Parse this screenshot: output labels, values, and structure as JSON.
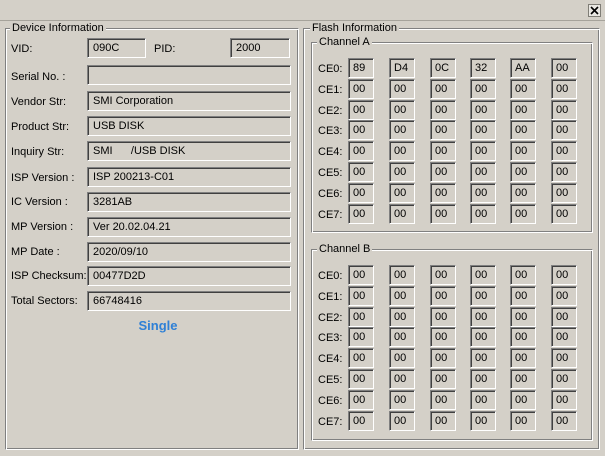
{
  "window": {
    "close_label": "close"
  },
  "device": {
    "title": "Device Information",
    "vid_label": "VID:",
    "vid": "090C",
    "pid_label": "PID:",
    "pid": "2000",
    "serial_label": "Serial No. :",
    "serial": "",
    "vendor_label": "Vendor Str:",
    "vendor": "SMI Corporation",
    "product_label": "Product Str:",
    "product": "USB DISK",
    "inquiry_label": "Inquiry Str:",
    "inquiry": "SMI      /USB DISK",
    "isp_version_label": "ISP Version :",
    "isp_version": "ISP 200213-C01",
    "ic_version_label": "IC Version :",
    "ic_version": "3281AB",
    "mp_version_label": "MP Version :",
    "mp_version": "Ver 20.02.04.21",
    "mp_date_label": "MP Date :",
    "mp_date": "2020/09/10",
    "isp_checksum_label": "ISP Checksum:",
    "isp_checksum": "00477D2D",
    "total_sectors_label": "Total Sectors:",
    "total_sectors": "66748416",
    "mode": "Single",
    "mode_color": "#2f80d6"
  },
  "flash": {
    "title": "Flash Information",
    "channels": [
      {
        "title": "Channel A",
        "rows": [
          {
            "label": "CE0:",
            "values": [
              "89",
              "D4",
              "0C",
              "32",
              "AA",
              "00"
            ]
          },
          {
            "label": "CE1:",
            "values": [
              "00",
              "00",
              "00",
              "00",
              "00",
              "00"
            ]
          },
          {
            "label": "CE2:",
            "values": [
              "00",
              "00",
              "00",
              "00",
              "00",
              "00"
            ]
          },
          {
            "label": "CE3:",
            "values": [
              "00",
              "00",
              "00",
              "00",
              "00",
              "00"
            ]
          },
          {
            "label": "CE4:",
            "values": [
              "00",
              "00",
              "00",
              "00",
              "00",
              "00"
            ]
          },
          {
            "label": "CE5:",
            "values": [
              "00",
              "00",
              "00",
              "00",
              "00",
              "00"
            ]
          },
          {
            "label": "CE6:",
            "values": [
              "00",
              "00",
              "00",
              "00",
              "00",
              "00"
            ]
          },
          {
            "label": "CE7:",
            "values": [
              "00",
              "00",
              "00",
              "00",
              "00",
              "00"
            ]
          }
        ]
      },
      {
        "title": "Channel B",
        "rows": [
          {
            "label": "CE0:",
            "values": [
              "00",
              "00",
              "00",
              "00",
              "00",
              "00"
            ]
          },
          {
            "label": "CE1:",
            "values": [
              "00",
              "00",
              "00",
              "00",
              "00",
              "00"
            ]
          },
          {
            "label": "CE2:",
            "values": [
              "00",
              "00",
              "00",
              "00",
              "00",
              "00"
            ]
          },
          {
            "label": "CE3:",
            "values": [
              "00",
              "00",
              "00",
              "00",
              "00",
              "00"
            ]
          },
          {
            "label": "CE4:",
            "values": [
              "00",
              "00",
              "00",
              "00",
              "00",
              "00"
            ]
          },
          {
            "label": "CE5:",
            "values": [
              "00",
              "00",
              "00",
              "00",
              "00",
              "00"
            ]
          },
          {
            "label": "CE6:",
            "values": [
              "00",
              "00",
              "00",
              "00",
              "00",
              "00"
            ]
          },
          {
            "label": "CE7:",
            "values": [
              "00",
              "00",
              "00",
              "00",
              "00",
              "00"
            ]
          }
        ]
      }
    ]
  }
}
